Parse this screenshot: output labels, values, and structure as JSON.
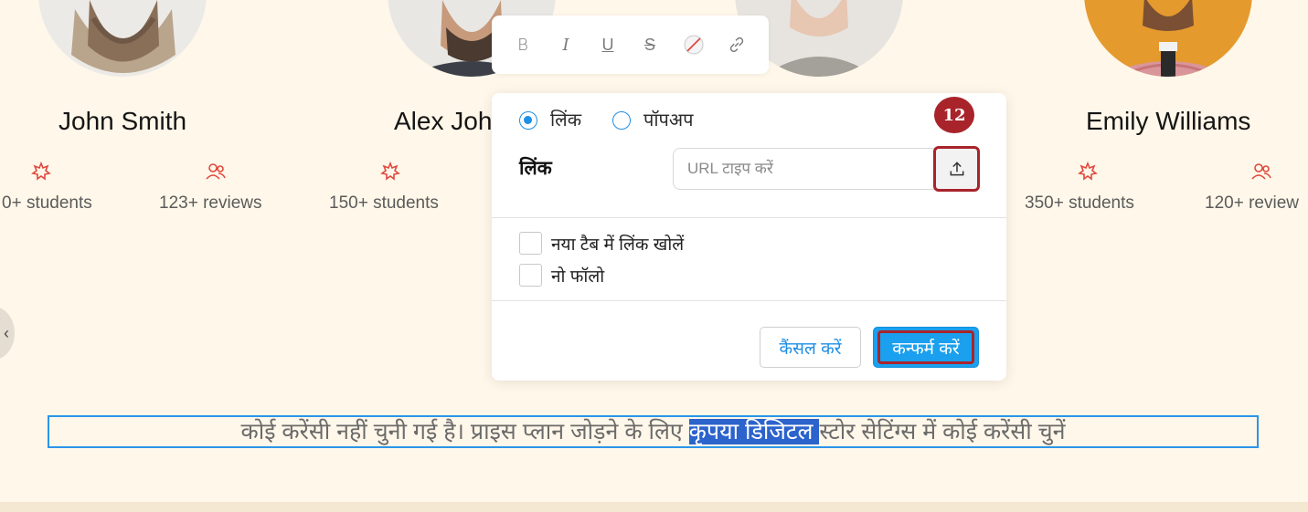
{
  "instructors": [
    {
      "name": "John Smith",
      "students": "0+ students",
      "reviews": "123+ reviews"
    },
    {
      "name": "Alex Joh",
      "students": "150+ students"
    },
    {
      "name": "Emily Williams",
      "students": "350+ students",
      "reviews": "120+ review"
    }
  ],
  "toolbar": {
    "bold": "B",
    "italic": "I",
    "underline": "U",
    "strike": "S"
  },
  "link_popup": {
    "radio_link": "लिंक",
    "radio_popup": "पॉपअप",
    "field_label": "लिंक",
    "url_placeholder": "URL टाइप करें",
    "url_value": "",
    "open_new_tab": "नया टैब में लिंक खोलें",
    "no_follow": "नो फॉलो",
    "cancel": "कैंसल करें",
    "confirm": "कन्फर्म करें",
    "selected_radio": "link"
  },
  "step_badge": "12",
  "notice": {
    "before": "कोई करेंसी नहीं चुनी गई है। प्राइस प्लान जोड़ने के लिए ",
    "selected": "कृपया डिजिटल ",
    "after": "स्टोर सेटिंग्स में कोई करेंसी चुनें"
  },
  "colors": {
    "page_bg": "#fff7e9",
    "accent_blue": "#1aa0ee",
    "highlight_red": "#a8242a",
    "stat_icon_red": "#e0483e",
    "selection_blue": "#2c63cc"
  }
}
